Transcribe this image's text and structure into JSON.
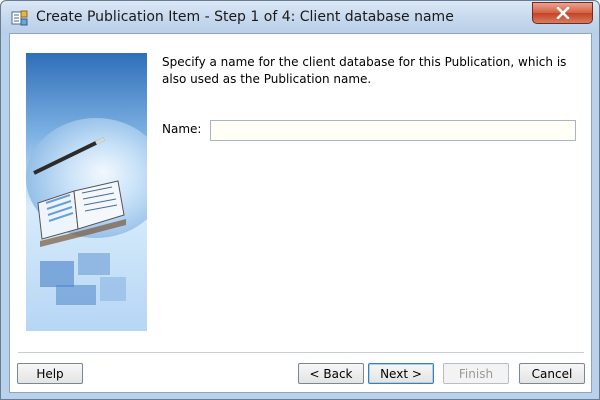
{
  "window": {
    "title": "Create Publication Item - Step 1 of 4: Client database name"
  },
  "content": {
    "description": "Specify a name for the client database for this Publication, which is also used as the Publication name.",
    "name_label": "Name:",
    "name_value": "",
    "name_placeholder": ""
  },
  "buttons": {
    "help": "Help",
    "back": "< Back",
    "next": "Next >",
    "finish": "Finish",
    "cancel": "Cancel"
  },
  "icons": {
    "app": "publication-icon",
    "close": "close-icon"
  },
  "colors": {
    "title_bar": "#c3d6ec",
    "close_button": "#c34326",
    "input_background": "#fffff6",
    "primary_border": "#3c7fb1",
    "disabled_text": "#9a9a9a"
  }
}
